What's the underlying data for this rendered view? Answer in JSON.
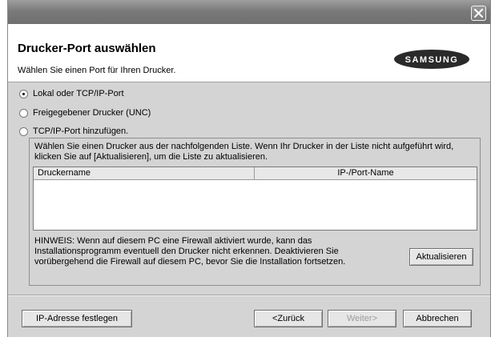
{
  "window": {
    "close_glyph": "×"
  },
  "header": {
    "title": "Drucker-Port auswählen",
    "subtitle": "Wählen Sie einen Port für Ihren Drucker.",
    "logo_text": "SAMSUNG"
  },
  "options": {
    "local": {
      "label": "Lokal oder TCP/IP-Port",
      "checked": true
    },
    "shared": {
      "label": "Freigegebener Drucker (UNC)",
      "checked": false
    },
    "add": {
      "label": "TCP/IP-Port hinzufügen.",
      "checked": false
    }
  },
  "group": {
    "description": "Wählen Sie einen Drucker aus der nachfolgenden Liste. Wenn Ihr Drucker in der Liste nicht aufgeführt wird, klicken Sie auf [Aktualisieren], um die Liste zu aktualisieren.",
    "columns": [
      "Druckername",
      "IP-/Port-Name"
    ],
    "rows": [],
    "hint": "HINWEIS: Wenn auf diesem PC eine Firewall aktiviert wurde, kann das Installationsprogramm eventuell den Drucker nicht erkennen. Deaktivieren Sie vorübergehend die Firewall auf diesem PC, bevor Sie die Installation fortsetzen.",
    "refresh_label": "Aktualisieren"
  },
  "footer": {
    "set_ip_label": "IP-Adresse festlegen",
    "back_label": "<Zurück",
    "next_label": "Weiter>",
    "cancel_label": "Abbrechen"
  }
}
